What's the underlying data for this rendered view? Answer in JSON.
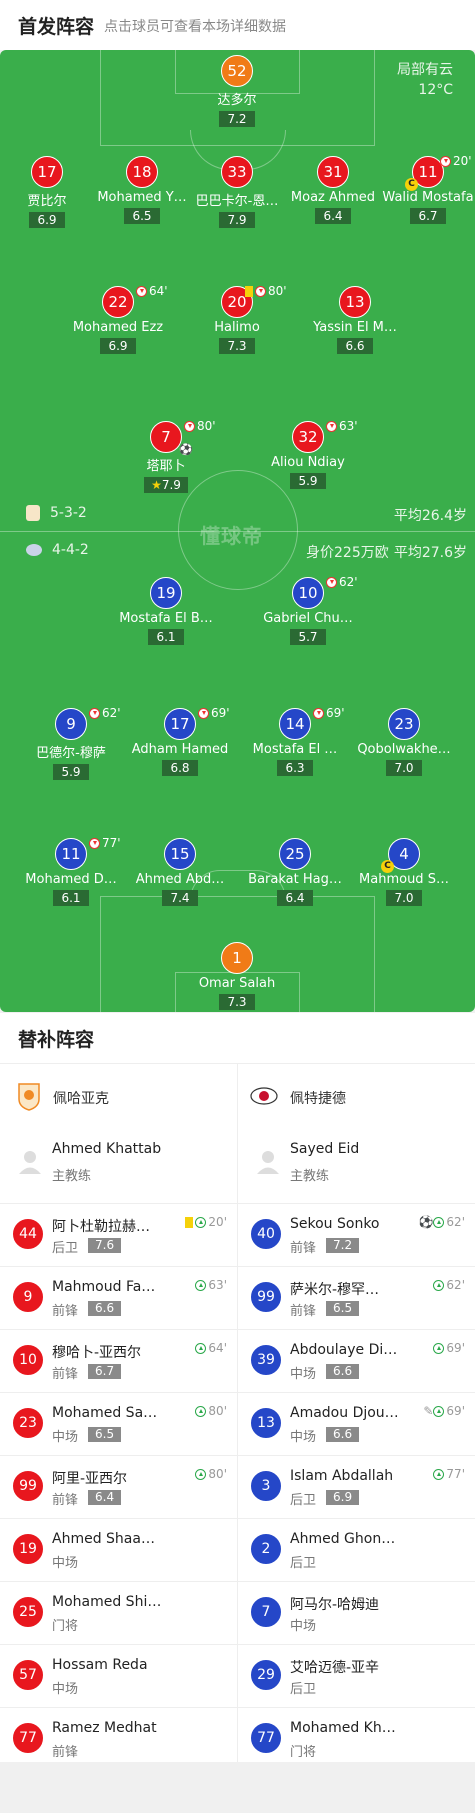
{
  "header": {
    "title": "首发阵容",
    "hint": "点击球员可查看本场详细数据"
  },
  "weather": {
    "condition": "局部有云",
    "temp": "12°C"
  },
  "watermark": "懂球帝",
  "home": {
    "formation": "5-3-2",
    "avg_age": "平均26.4岁",
    "players": [
      {
        "num": "52",
        "name": "达多尔",
        "rating": "7.2"
      },
      {
        "num": "17",
        "name": "贾比尔",
        "rating": "6.9"
      },
      {
        "num": "18",
        "name": "Mohamed Y…",
        "rating": "6.5"
      },
      {
        "num": "33",
        "name": "巴巴卡尔-恩…",
        "rating": "7.9"
      },
      {
        "num": "31",
        "name": "Moaz Ahmed",
        "rating": "6.4"
      },
      {
        "num": "11",
        "name": "Walid Mostafa",
        "rating": "6.7",
        "event": "20'"
      },
      {
        "num": "22",
        "name": "Mohamed Ezz",
        "rating": "6.9",
        "event": "64'"
      },
      {
        "num": "20",
        "name": "Halimo",
        "rating": "7.3",
        "event": "80'"
      },
      {
        "num": "13",
        "name": "Yassin El M…",
        "rating": "6.6"
      },
      {
        "num": "7",
        "name": "塔耶卜",
        "rating": "7.9",
        "event": "80'"
      },
      {
        "num": "32",
        "name": "Aliou Ndiay",
        "rating": "5.9",
        "event": "63'"
      }
    ]
  },
  "away": {
    "formation": "4-4-2",
    "value": "身价225万欧",
    "avg_age": "平均27.6岁",
    "players": [
      {
        "num": "19",
        "name": "Mostafa El B…",
        "rating": "6.1"
      },
      {
        "num": "10",
        "name": "Gabriel Chu…",
        "rating": "5.7",
        "event": "62'"
      },
      {
        "num": "9",
        "name": "巴德尔-穆萨",
        "rating": "5.9",
        "event": "62'"
      },
      {
        "num": "17",
        "name": "Adham Hamed",
        "rating": "6.8",
        "event": "69'"
      },
      {
        "num": "14",
        "name": "Mostafa El …",
        "rating": "6.3",
        "event": "69'"
      },
      {
        "num": "23",
        "name": "Qobolwakhe…",
        "rating": "7.0"
      },
      {
        "num": "11",
        "name": "Mohamed D…",
        "rating": "6.1",
        "event": "77'"
      },
      {
        "num": "15",
        "name": "Ahmed Abd…",
        "rating": "7.4"
      },
      {
        "num": "25",
        "name": "Barakat Hag…",
        "rating": "6.4"
      },
      {
        "num": "4",
        "name": "Mahmoud S…",
        "rating": "7.0"
      },
      {
        "num": "1",
        "name": "Omar Salah",
        "rating": "7.3"
      }
    ]
  },
  "subs": {
    "title": "替补阵容",
    "home_team": "佩哈亚克",
    "away_team": "佩特捷德",
    "home_coach": {
      "name": "Ahmed Khattab",
      "role": "主教练"
    },
    "away_coach": {
      "name": "Sayed Eid",
      "role": "主教练"
    },
    "home": [
      {
        "num": "44",
        "name": "阿卜杜勒拉赫…",
        "pos": "后卫",
        "rating": "7.6",
        "event": "20'"
      },
      {
        "num": "9",
        "name": "Mahmoud Fa…",
        "pos": "前锋",
        "rating": "6.6",
        "event": "63'"
      },
      {
        "num": "10",
        "name": "穆哈卜-亚西尔",
        "pos": "前锋",
        "rating": "6.7",
        "event": "64'"
      },
      {
        "num": "23",
        "name": "Mohamed Sa…",
        "pos": "中场",
        "rating": "6.5",
        "event": "80'"
      },
      {
        "num": "99",
        "name": "阿里-亚西尔",
        "pos": "前锋",
        "rating": "6.4",
        "event": "80'"
      },
      {
        "num": "19",
        "name": "Ahmed Shaa…",
        "pos": "中场"
      },
      {
        "num": "25",
        "name": "Mohamed Shi…",
        "pos": "门将"
      },
      {
        "num": "57",
        "name": "Hossam Reda",
        "pos": "中场"
      },
      {
        "num": "77",
        "name": "Ramez Medhat",
        "pos": "前锋"
      }
    ],
    "away": [
      {
        "num": "40",
        "name": "Sekou Sonko",
        "pos": "前锋",
        "rating": "7.2",
        "event": "62'"
      },
      {
        "num": "99",
        "name": "萨米尔-穆罕…",
        "pos": "前锋",
        "rating": "6.5",
        "event": "62'"
      },
      {
        "num": "39",
        "name": "Abdoulaye Di…",
        "pos": "中场",
        "rating": "6.6",
        "event": "69'"
      },
      {
        "num": "13",
        "name": "Amadou Djou…",
        "pos": "中场",
        "rating": "6.6",
        "event": "69'"
      },
      {
        "num": "3",
        "name": "Islam Abdallah",
        "pos": "后卫",
        "rating": "6.9",
        "event": "77'"
      },
      {
        "num": "2",
        "name": "Ahmed Ghon…",
        "pos": "后卫"
      },
      {
        "num": "7",
        "name": "阿马尔-哈姆迪",
        "pos": "中场"
      },
      {
        "num": "29",
        "name": "艾哈迈德-亚辛",
        "pos": "后卫"
      },
      {
        "num": "77",
        "name": "Mohamed Kh…",
        "pos": "门将"
      }
    ]
  }
}
